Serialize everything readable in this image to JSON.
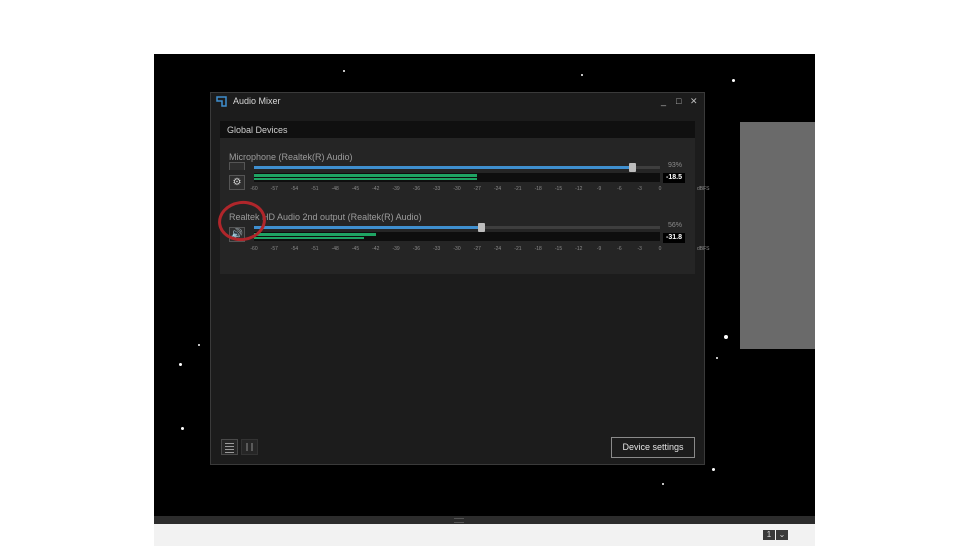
{
  "window": {
    "title": "Audio Mixer",
    "minimize_glyph": "_",
    "maximize_glyph": "□",
    "close_glyph": "✕"
  },
  "global_devices": {
    "header": "Global Devices",
    "devices": [
      {
        "name": "Microphone (Realtek(R) Audio)",
        "volume_label": "93%",
        "volume_level": 0.93,
        "level_db": "-18.5",
        "meter_fraction": 0.55,
        "button_icon": "gear-icon"
      },
      {
        "name": "Realtek HD Audio 2nd output (Realtek(R) Audio)",
        "volume_label": "56%",
        "volume_level": 0.56,
        "level_db": "-31.8",
        "meter_fraction_a": 0.3,
        "meter_fraction_b": 0.27,
        "button_icon": "speaker-icon"
      }
    ]
  },
  "scale": {
    "ticks": [
      "-60",
      "-57",
      "-54",
      "-51",
      "-48",
      "-45",
      "-42",
      "-39",
      "-36",
      "-33",
      "-30",
      "-27",
      "-24",
      "-21",
      "-18",
      "-15",
      "-12",
      "-9",
      "-6",
      "-3",
      "0"
    ],
    "unit": "dBFS"
  },
  "footer": {
    "device_settings_label": "Device settings",
    "view_icons": [
      "list-view-icon",
      "grid-view-icon"
    ]
  },
  "colors": {
    "accent_blue": "#3f8fcf",
    "meter_green": "#1fa463",
    "annotation_red": "#b0262b"
  },
  "bottom_strip": {
    "page_button": "1",
    "dropdown_glyph": "⌄"
  }
}
